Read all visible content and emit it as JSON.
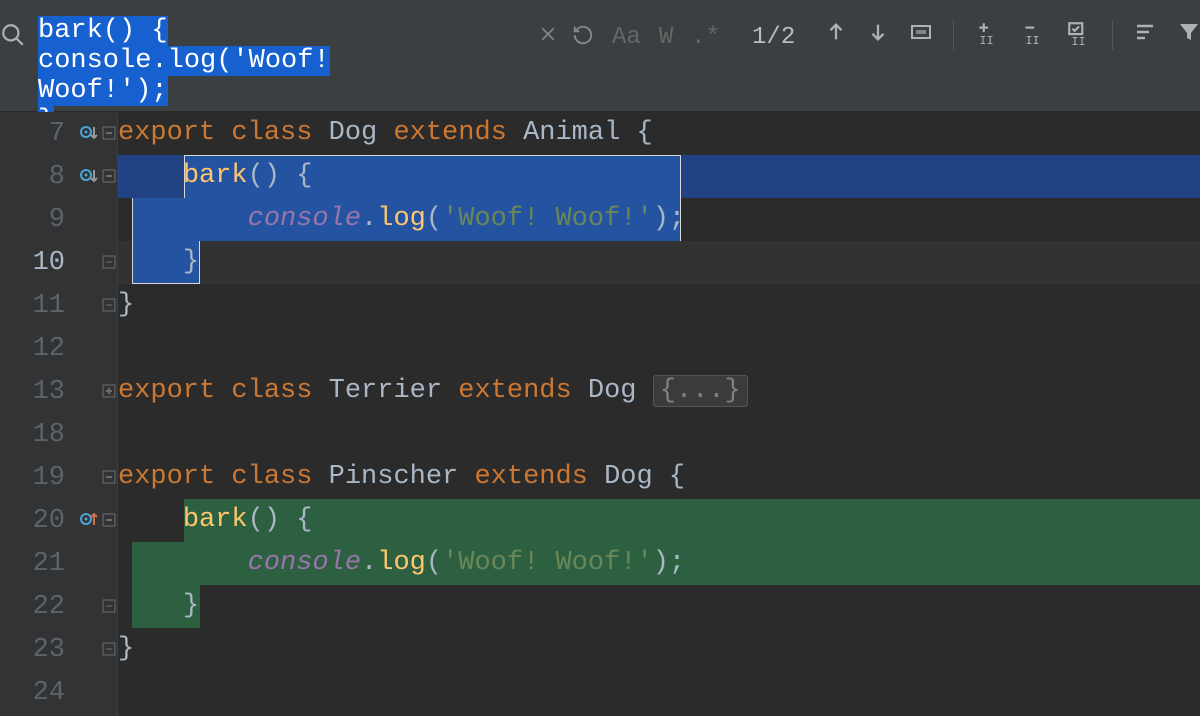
{
  "find": {
    "query_line1": "bark() {",
    "query_line2": "    console.log('Woof! Woof!');",
    "query_line3": "}",
    "counter": "1/2",
    "options": {
      "aa": "Aa",
      "word": "W",
      "regex": ".*"
    }
  },
  "gutter": {
    "l7": "7",
    "l8": "8",
    "l9": "9",
    "l10": "10",
    "l11": "11",
    "l12": "12",
    "l13": "13",
    "l18": "18",
    "l19": "19",
    "l20": "20",
    "l21": "21",
    "l22": "22",
    "l23": "23",
    "l24": "24"
  },
  "code": {
    "l7": {
      "kw1": "export",
      "kw2": "class",
      "name": "Dog",
      "kw3": "extends",
      "super": "Animal",
      "open": " {"
    },
    "l8": {
      "indent": "    ",
      "fn": "bark",
      "rest": "() {"
    },
    "l9": {
      "indent": "        ",
      "obj": "console",
      "dot": ".",
      "fn": "log",
      "lp": "(",
      "str": "'Woof! Woof!'",
      "rp": ");"
    },
    "l10": {
      "indent": "    ",
      "close": "}"
    },
    "l11": {
      "close": "}"
    },
    "l13": {
      "kw1": "export",
      "kw2": "class",
      "name": "Terrier",
      "kw3": "extends",
      "super": "Dog",
      "fold": "{...}"
    },
    "l19": {
      "kw1": "export",
      "kw2": "class",
      "name": "Pinscher",
      "kw3": "extends",
      "super": "Dog",
      "open": " {"
    },
    "l20": {
      "indent": "    ",
      "fn": "bark",
      "rest": "() {"
    },
    "l21": {
      "indent": "        ",
      "obj": "console",
      "dot": ".",
      "fn": "log",
      "lp": "(",
      "str": "'Woof! Woof!'",
      "rp": ");"
    },
    "l22": {
      "indent": "    ",
      "close": "}"
    },
    "l23": {
      "close": "}"
    }
  }
}
